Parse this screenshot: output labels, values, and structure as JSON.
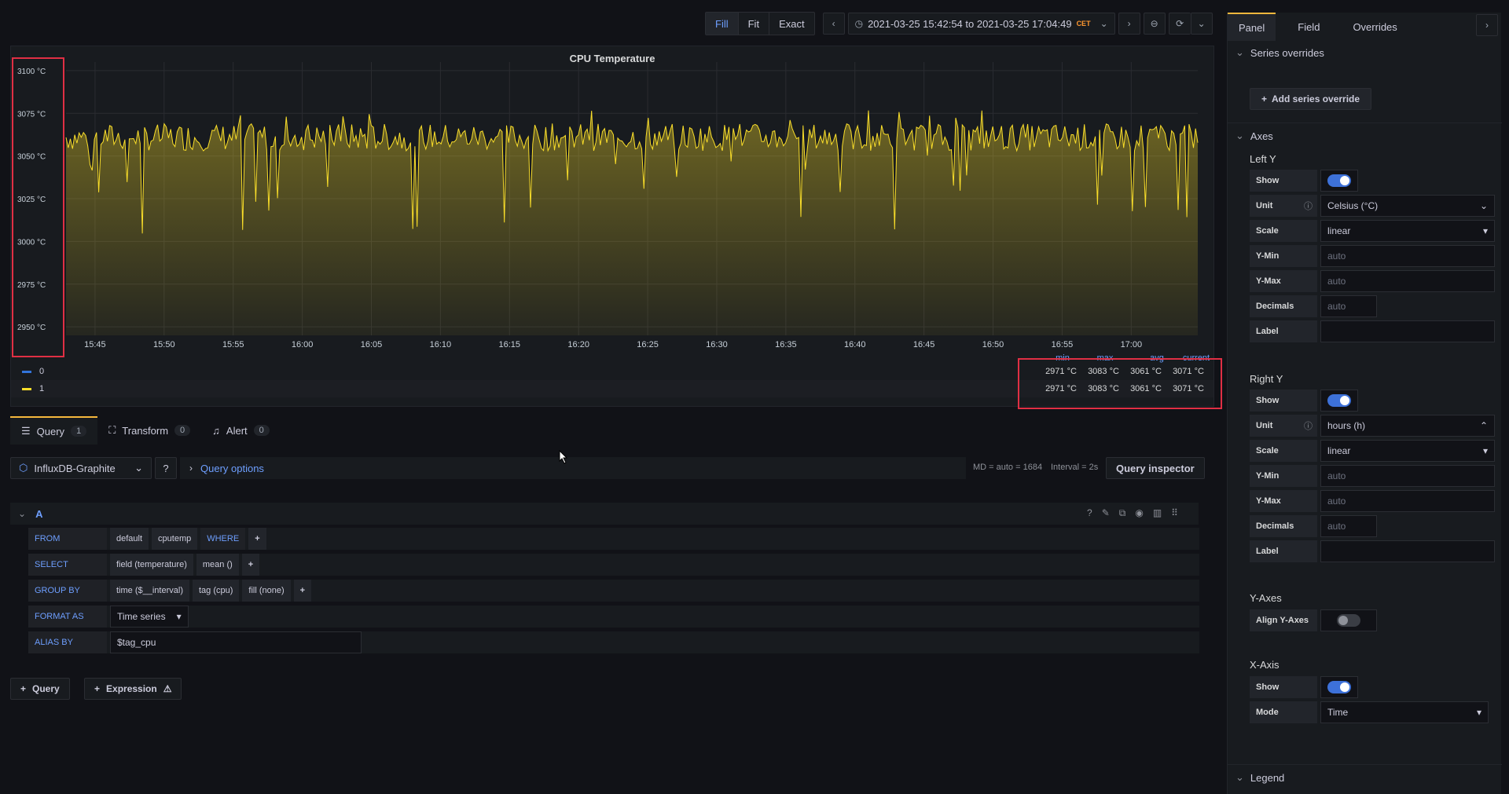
{
  "toolbar": {
    "fill": "Fill",
    "fit": "Fit",
    "exact": "Exact",
    "time_range": "2021-03-25 15:42:54 to 2021-03-25 17:04:49",
    "timezone": "CET"
  },
  "panel": {
    "title": "CPU Temperature"
  },
  "chart_data": {
    "type": "area",
    "title": "CPU Temperature",
    "x_ticks": [
      "15:45",
      "15:50",
      "15:55",
      "16:00",
      "16:05",
      "16:10",
      "16:15",
      "16:20",
      "16:25",
      "16:30",
      "16:35",
      "16:40",
      "16:45",
      "16:50",
      "16:55",
      "17:00"
    ],
    "y_ticks": [
      "3100 °C",
      "3075 °C",
      "3050 °C",
      "3025 °C",
      "3000 °C",
      "2975 °C",
      "2950 °C"
    ],
    "ylim": [
      2945,
      3105
    ],
    "xlim": [
      "15:42:54",
      "17:04:49"
    ],
    "series": [
      {
        "name": "0",
        "color": "#3274d9",
        "min": 2971,
        "max": 3083,
        "avg": 3061,
        "current": 3071
      },
      {
        "name": "1",
        "color": "#fade2a",
        "min": 2971,
        "max": 3083,
        "avg": 3061,
        "current": 3071
      }
    ],
    "grid": true
  },
  "legend": {
    "headers": [
      "min",
      "max",
      "avg",
      "current"
    ],
    "rows": [
      {
        "name": "0",
        "min": "2971 °C",
        "max": "3083 °C",
        "avg": "3061 °C",
        "current": "3071 °C"
      },
      {
        "name": "1",
        "min": "2971 °C",
        "max": "3083 °C",
        "avg": "3061 °C",
        "current": "3071 °C"
      }
    ]
  },
  "query_tabs": [
    {
      "label": "Query",
      "count": "1"
    },
    {
      "label": "Transform",
      "count": "0"
    },
    {
      "label": "Alert",
      "count": "0"
    }
  ],
  "query_bar": {
    "datasource": "InfluxDB-Graphite",
    "options": "Query options",
    "md": "MD = auto = 1684",
    "interval": "Interval = 2s",
    "inspector": "Query inspector"
  },
  "query": {
    "ref": "A",
    "from_label": "FROM",
    "from_policy": "default",
    "from_measurement": "cputemp",
    "where": "WHERE",
    "select_label": "SELECT",
    "select_field": "field (temperature)",
    "select_fn": "mean ()",
    "group_label": "GROUP BY",
    "group_time": "time ($__interval)",
    "group_tag": "tag (cpu)",
    "group_fill": "fill (none)",
    "format_label": "FORMAT AS",
    "format_value": "Time series",
    "alias_label": "ALIAS BY",
    "alias_value": "$tag_cpu"
  },
  "add_buttons": {
    "query": "Query",
    "expression": "Expression"
  },
  "options": {
    "tabs": [
      "Panel",
      "Field",
      "Overrides"
    ],
    "series_overrides": "Series overrides",
    "add_override": "Add series override",
    "axes": "Axes",
    "left_y": {
      "title": "Left Y",
      "show": "Show",
      "unit": "Unit",
      "unit_value": "Celsius (°C)",
      "scale": "Scale",
      "scale_value": "linear",
      "ymin": "Y-Min",
      "ymin_ph": "auto",
      "ymax": "Y-Max",
      "ymax_ph": "auto",
      "decimals": "Decimals",
      "decimals_ph": "auto",
      "label": "Label"
    },
    "right_y": {
      "title": "Right Y",
      "show": "Show",
      "unit": "Unit",
      "unit_value": "hours (h)",
      "scale": "Scale",
      "scale_value": "linear",
      "ymin": "Y-Min",
      "ymin_ph": "auto",
      "ymax": "Y-Max",
      "ymax_ph": "auto",
      "decimals": "Decimals",
      "decimals_ph": "auto",
      "label": "Label"
    },
    "y_axes": {
      "title": "Y-Axes",
      "align": "Align Y-Axes"
    },
    "x_axis": {
      "title": "X-Axis",
      "show": "Show",
      "mode": "Mode",
      "mode_value": "Time"
    },
    "legend": "Legend"
  }
}
